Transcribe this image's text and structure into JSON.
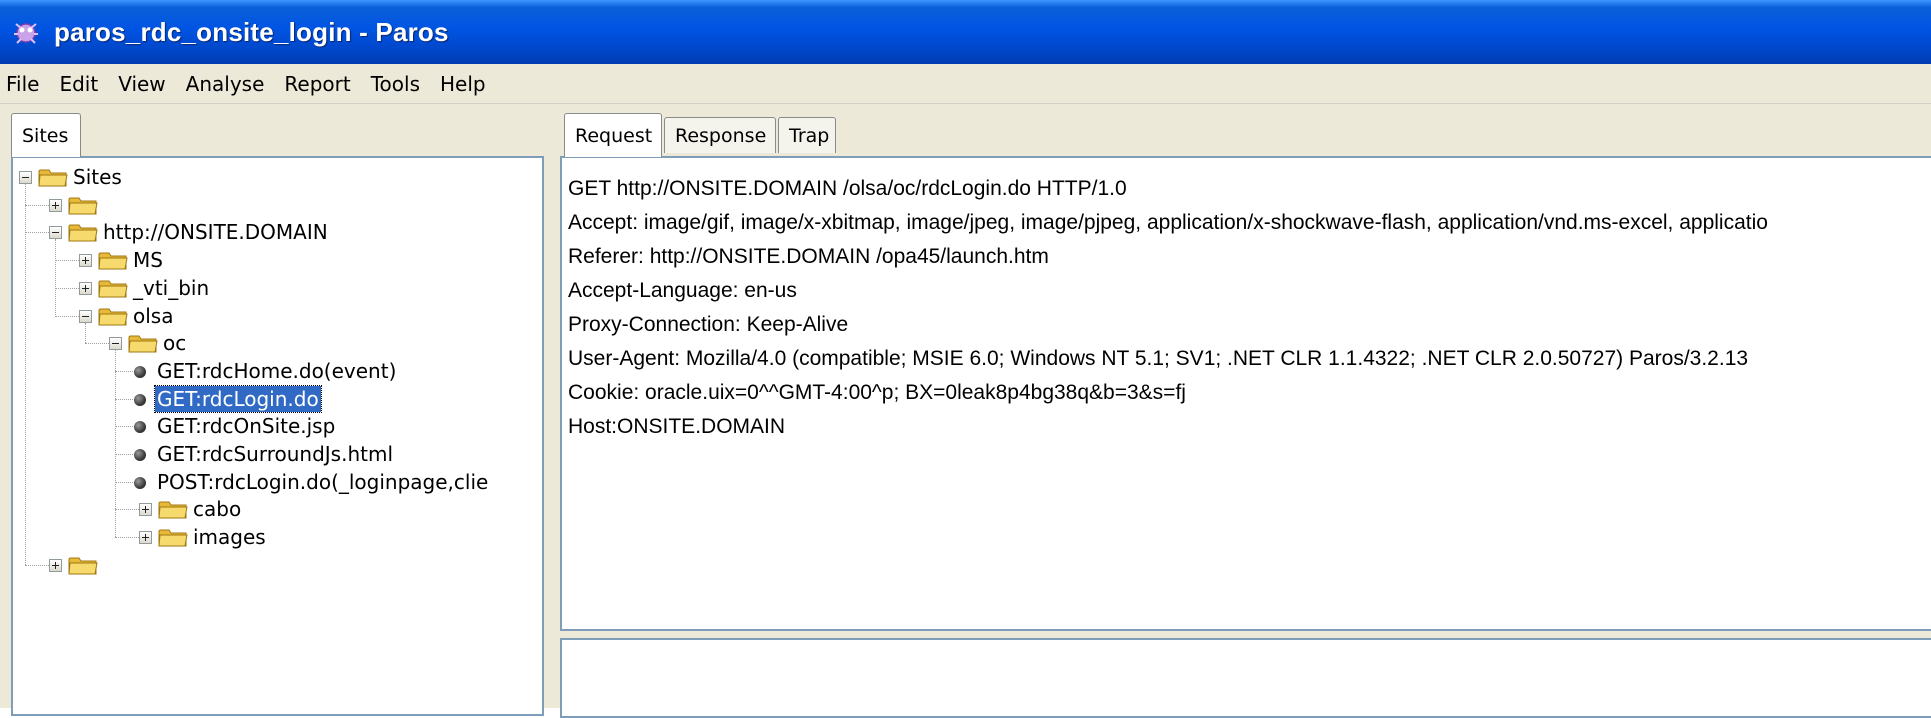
{
  "window": {
    "title": "paros_rdc_onsite_login - Paros",
    "app_icon": "paros-bug-icon"
  },
  "menu": [
    "File",
    "Edit",
    "View",
    "Analyse",
    "Report",
    "Tools",
    "Help"
  ],
  "left_panel": {
    "tab": "Sites",
    "tree": [
      {
        "label": "Sites",
        "expander": "minus",
        "icon": "folder"
      },
      {
        "label": "",
        "expander": "plus",
        "icon": "folder"
      },
      {
        "label": "http://ONSITE.DOMAIN",
        "expander": "minus",
        "icon": "folder"
      },
      {
        "label": "MS",
        "expander": "plus",
        "icon": "folder"
      },
      {
        "label": "_vti_bin",
        "expander": "plus",
        "icon": "folder"
      },
      {
        "label": "olsa",
        "expander": "minus",
        "icon": "folder"
      },
      {
        "label": "oc",
        "expander": "minus",
        "icon": "folder"
      },
      {
        "label": "GET:rdcHome.do(event)",
        "icon": "bullet"
      },
      {
        "label": "GET:rdcLogin.do",
        "icon": "bullet",
        "selected": true
      },
      {
        "label": "GET:rdcOnSite.jsp",
        "icon": "bullet"
      },
      {
        "label": "GET:rdcSurroundJs.html",
        "icon": "bullet"
      },
      {
        "label": "POST:rdcLogin.do(_loginpage,clie",
        "icon": "bullet"
      },
      {
        "label": "cabo",
        "expander": "plus",
        "icon": "folder"
      },
      {
        "label": "images",
        "expander": "plus",
        "icon": "folder"
      },
      {
        "label": "",
        "expander": "plus",
        "icon": "folder"
      }
    ]
  },
  "right_panel": {
    "tabs": [
      "Request",
      "Response",
      "Trap"
    ],
    "active_tab": "Request",
    "request_header": [
      "GET http://ONSITE.DOMAIN  /olsa/oc/rdcLogin.do HTTP/1.0",
      "Accept: image/gif, image/x-xbitmap, image/jpeg, image/pjpeg, application/x-shockwave-flash, application/vnd.ms-excel, applicatio",
      "Referer: http://ONSITE.DOMAIN /opa45/launch.htm",
      "Accept-Language: en-us",
      "Proxy-Connection: Keep-Alive",
      "User-Agent: Mozilla/4.0 (compatible; MSIE 6.0; Windows NT 5.1; SV1; .NET CLR 1.1.4322; .NET CLR 2.0.50727) Paros/3.2.13",
      "Cookie: oracle.uix=0^^GMT-4:00^p; BX=0leak8p4bg38q&b=3&s=fj",
      "Host:ONSITE.DOMAIN"
    ],
    "request_body": ""
  },
  "colors": {
    "titlebar": "#0054e3",
    "selection": "#316ac5",
    "chrome": "#ece9d8",
    "folder": "#f6d66c"
  }
}
